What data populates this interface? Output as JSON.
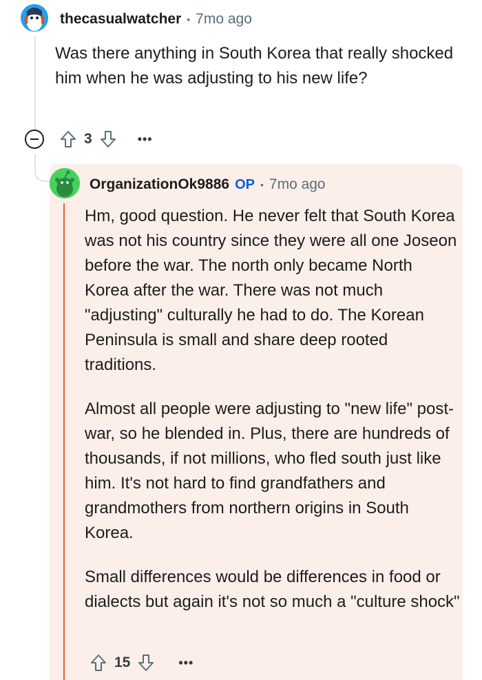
{
  "parent_comment": {
    "avatar_icon": "snoo-avatar-blue-icon",
    "username": "thecasualwatcher",
    "separator": "•",
    "timestamp": "7mo ago",
    "body": "Was there anything in South Korea that really shocked him when he was adjusting to his new life?",
    "score": "3",
    "more_label": "•••"
  },
  "reply_comment": {
    "avatar_icon": "snoo-avatar-green-icon",
    "username": "OrganizationOk9886",
    "op_badge": "OP",
    "separator": "•",
    "timestamp": "7mo ago",
    "paragraphs": [
      "Hm, good question. He never felt that South Korea was not his country since they were all one Joseon before the war. The north only became North Korea after the war. There was not much \"adjusting\" culturally he had to do. The Korean Peninsula is small and share deep rooted traditions.",
      "Almost all people were adjusting to \"new life\" post-war, so he blended in. Plus, there are hundreds of thousands, if not millions, who fled south just like him. It's not hard to find grandfathers and grandmothers from northern origins in South Korea.",
      "Small differences would be differences in food or dialects but again it's not so much a \"culture shock\""
    ],
    "score": "15",
    "more_label": "•••"
  },
  "colors": {
    "reply_background": "#fcefea",
    "thread_highlight": "#e8593b",
    "op_badge": "#0a60d6",
    "thread_line": "#dfe3e6"
  }
}
